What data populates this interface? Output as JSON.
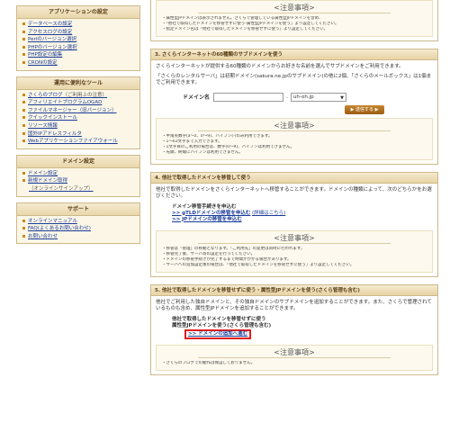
{
  "sidebar": {
    "box1": {
      "title": "アプリケーションの設定",
      "items": [
        "データベースの設定",
        "アクセスログの設定",
        "Perlのバージョン選択",
        "PHPのバージョン選択",
        "PHP設定の編集",
        "CRONの設定"
      ]
    },
    "box2": {
      "title": "運用に便利なツール",
      "items": [
        "さくらのブログ",
        "アフィリエイトプログラムOGAD",
        "ファイルマネージャー",
        "クイックインストール",
        "リソース情報",
        "国外IPアドレスフィルタ",
        "Webアプリケーションファイアウォール"
      ],
      "blog_note": "（ご利用上の注意）",
      "fm_note": "（旧バージョン）"
    },
    "box3": {
      "title": "ドメイン設定",
      "items": [
        "ドメイン設定",
        "新規ドメイン取得"
      ],
      "sub_note": "（オンラインサインアップ）"
    },
    "box4": {
      "title": "サポート",
      "items": [
        "オンラインマニュアル",
        "FAQ(よくあるお問い合わせ)",
        "お問い合わせ"
      ]
    }
  },
  "panel_top": {
    "notice_title": "<注意事項>",
    "notes": [
      "属性型JPドメインは表示されません。さくらで管理している属性型JPドメインを含め、",
      "「他社で取得したドメインを移管せずに使う-属性型JPドメインを使う」より設定してください。",
      "指定ドメイン名は「他社で取得したドメインを移管せずに使う」より設定してください。"
    ]
  },
  "panel_sub": {
    "title": "3. さくらインターネットの60種類のサブドメインを使う",
    "desc1": "さくらインターネットが提供する60種類のドメインからお好きな名前を選んでサブドメインをご利用できます。",
    "desc2": "「さくらのレンタルサーバ」は初期ドメイン(sakura.ne.jpのサブドメイン)の他に2個、「さくらのメールボックス」は1個までご利用できます。",
    "domain_label": "ドメイン名",
    "domain_value": "",
    "select_value": "uh-oh.jp",
    "send_label": "▶ 送信する ▶",
    "notice_title": "<注意事項>",
    "notes": [
      "半角英数字(a～z、0～9)、ハイフン(-)のみ利用できます。",
      "1～63文字まで入力できます。",
      "1文字目のご利用の場合は、数字(0～9)、ハイフンは利用できません。",
      "先頭、終端にハイフンは利用できません。"
    ]
  },
  "panel_transfer": {
    "title": "4. 他社で取得したドメインを移管して使う",
    "desc": "他社で取得したドメインをさくらインターネットへ移管することができます。ドメインの種類によって、次のどちらかをお選びください。",
    "box_title": "ドメイン移管手続きを申込む",
    "link1": ">> gTLDドメインの移管を申込む",
    "link1_note": "(詳細はこちら)",
    "link2": ">> JPドメインの移管を申込む",
    "notice_title": "<注意事項>",
    "notes": [
      "移管は「管理」の移動となります。「ご利用先」の変更は同時に行われます。",
      "移管完了後、サーバ等の設定を行ってください。",
      "ドメインの移管手続きが完了するまで時間がかかる場合があります。",
      "サーバへの追加設定後の場合は、「他社で取得したドメインを移管せずに使う」より設定してください。"
    ]
  },
  "panel_nontransfer": {
    "title": "5. 他社で取得したドメインを移管せずに使う・属性型JPドメインを使う(さくら管理も含む)",
    "desc": "他社でご利用した独自ドメインと、その独自ドメインのサブドメインを追加することができます。また、さくらで管理されているものも含め、属性型JPドメインを追加することができます。",
    "item1": "他社で取得したドメインを移管せずに使う",
    "item2": "属性型JPドメインを使う(さくら管理も含む)",
    "link": ">> ドメインの追加へ進む",
    "notice_title": "<注意事項>",
    "notes": [
      "さくらのブログでの動作は保証しておりません。"
    ]
  }
}
